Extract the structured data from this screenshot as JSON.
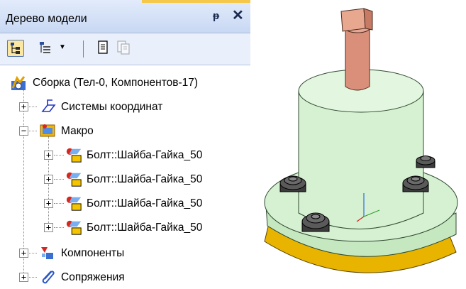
{
  "panel": {
    "title": "Дерево модели",
    "pin_glyph": "ᵽ",
    "close_glyph": "✕"
  },
  "toolbar": {
    "buttons": [
      "tree-structure-icon",
      "tree-view-mode-icon",
      "dropdown-arrow-icon",
      "document-icon",
      "document-copy-icon"
    ],
    "dropdown_arrow": "▼"
  },
  "tree": {
    "root": {
      "label": "Сборка (Тел-0, Компонентов-17)",
      "icon": "assembly-icon"
    },
    "items": [
      {
        "label": "Системы координат",
        "icon": "coordinate-system-icon",
        "expander": "+"
      },
      {
        "label": "Макро",
        "icon": "macro-icon",
        "expander": "−"
      },
      {
        "label": "Болт::Шайба-Гайка_50",
        "icon": "bolt-macro-icon",
        "expander": "+"
      },
      {
        "label": "Болт::Шайба-Гайка_50",
        "icon": "bolt-macro-icon",
        "expander": "+"
      },
      {
        "label": "Болт::Шайба-Гайка_50",
        "icon": "bolt-macro-icon",
        "expander": "+"
      },
      {
        "label": "Болт::Шайба-Гайка_50",
        "icon": "bolt-macro-icon",
        "expander": "+"
      },
      {
        "label": "Компоненты",
        "icon": "components-icon",
        "expander": "+"
      },
      {
        "label": "Сопряжения",
        "icon": "mates-icon",
        "expander": "+"
      }
    ]
  },
  "view": {
    "body_color": "#d6f0d2",
    "flange_color": "#e8b400",
    "shaft_color": "#d98f7a",
    "bolt_color": "#3c3c3c"
  }
}
